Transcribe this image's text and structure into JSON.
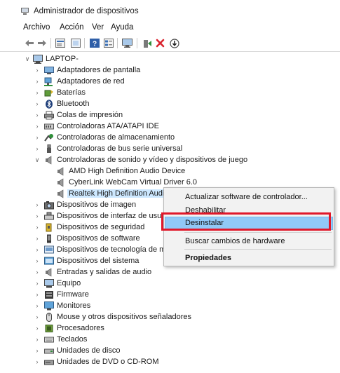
{
  "window": {
    "title": "Administrador de dispositivos",
    "app_icon": "device-manager-icon"
  },
  "menu": [
    "Archivo",
    "Acción",
    "Ver",
    "Ayuda"
  ],
  "toolbar": {
    "buttons": [
      "back-arrow-icon",
      "forward-arrow-icon",
      "properties-icon",
      "show-hidden-icon",
      "help-icon",
      "view-icon",
      "monitor-icon",
      "update-driver-icon",
      "uninstall-x-icon",
      "download-icon"
    ],
    "colors": {
      "uninstall": "#d9232e",
      "update": "#2f8f3a"
    }
  },
  "tree": {
    "root": "LAPTOP-",
    "items": [
      {
        "label": "Adaptadores de pantalla",
        "icon": "display-adapter-icon"
      },
      {
        "label": "Adaptadores de red",
        "icon": "network-adapter-icon"
      },
      {
        "label": "Baterías",
        "icon": "battery-icon"
      },
      {
        "label": "Bluetooth",
        "icon": "bluetooth-icon"
      },
      {
        "label": "Colas de impresión",
        "icon": "printer-icon"
      },
      {
        "label": "Controladoras ATA/ATAPI IDE",
        "icon": "ide-controller-icon"
      },
      {
        "label": "Controladoras de almacenamiento",
        "icon": "storage-controller-icon"
      },
      {
        "label": "Controladoras de bus serie universal",
        "icon": "usb-icon"
      },
      {
        "label": "Controladoras de sonido y vídeo y dispositivos de juego",
        "icon": "audio-icon",
        "expanded": true
      },
      {
        "label": "AMD High Definition Audio Device",
        "icon": "speaker-icon",
        "child": true
      },
      {
        "label": "CyberLink WebCam Virtual Driver 6.0",
        "icon": "speaker-icon",
        "child": true
      },
      {
        "label": "Realtek High Definition Audio",
        "icon": "speaker-icon",
        "child": true,
        "selected": true
      },
      {
        "label": "Dispositivos de imagen",
        "icon": "camera-icon"
      },
      {
        "label": "Dispositivos de interfaz de usuario",
        "icon": "hid-icon"
      },
      {
        "label": "Dispositivos de seguridad",
        "icon": "security-device-icon"
      },
      {
        "label": "Dispositivos de software",
        "icon": "software-device-icon"
      },
      {
        "label": "Dispositivos de tecnología de me",
        "icon": "memory-tech-icon"
      },
      {
        "label": "Dispositivos del sistema",
        "icon": "system-device-icon"
      },
      {
        "label": "Entradas y salidas de audio",
        "icon": "audio-io-icon"
      },
      {
        "label": "Equipo",
        "icon": "computer-icon"
      },
      {
        "label": "Firmware",
        "icon": "firmware-icon"
      },
      {
        "label": "Monitores",
        "icon": "monitor-icon"
      },
      {
        "label": "Mouse y otros dispositivos señaladores",
        "icon": "mouse-icon"
      },
      {
        "label": "Procesadores",
        "icon": "processor-icon"
      },
      {
        "label": "Teclados",
        "icon": "keyboard-icon"
      },
      {
        "label": "Unidades de disco",
        "icon": "disk-drive-icon"
      },
      {
        "label": "Unidades de DVD o CD-ROM",
        "icon": "dvd-icon"
      }
    ]
  },
  "context_menu": {
    "items": [
      {
        "label": "Actualizar software de controlador..."
      },
      {
        "label": "Deshabilitar"
      },
      {
        "label": "Desinstalar",
        "highlighted": true
      },
      {
        "label": "Buscar cambios de hardware"
      },
      {
        "label": "Propiedades",
        "bold": true
      }
    ],
    "highlight_color": "#e0182a"
  }
}
